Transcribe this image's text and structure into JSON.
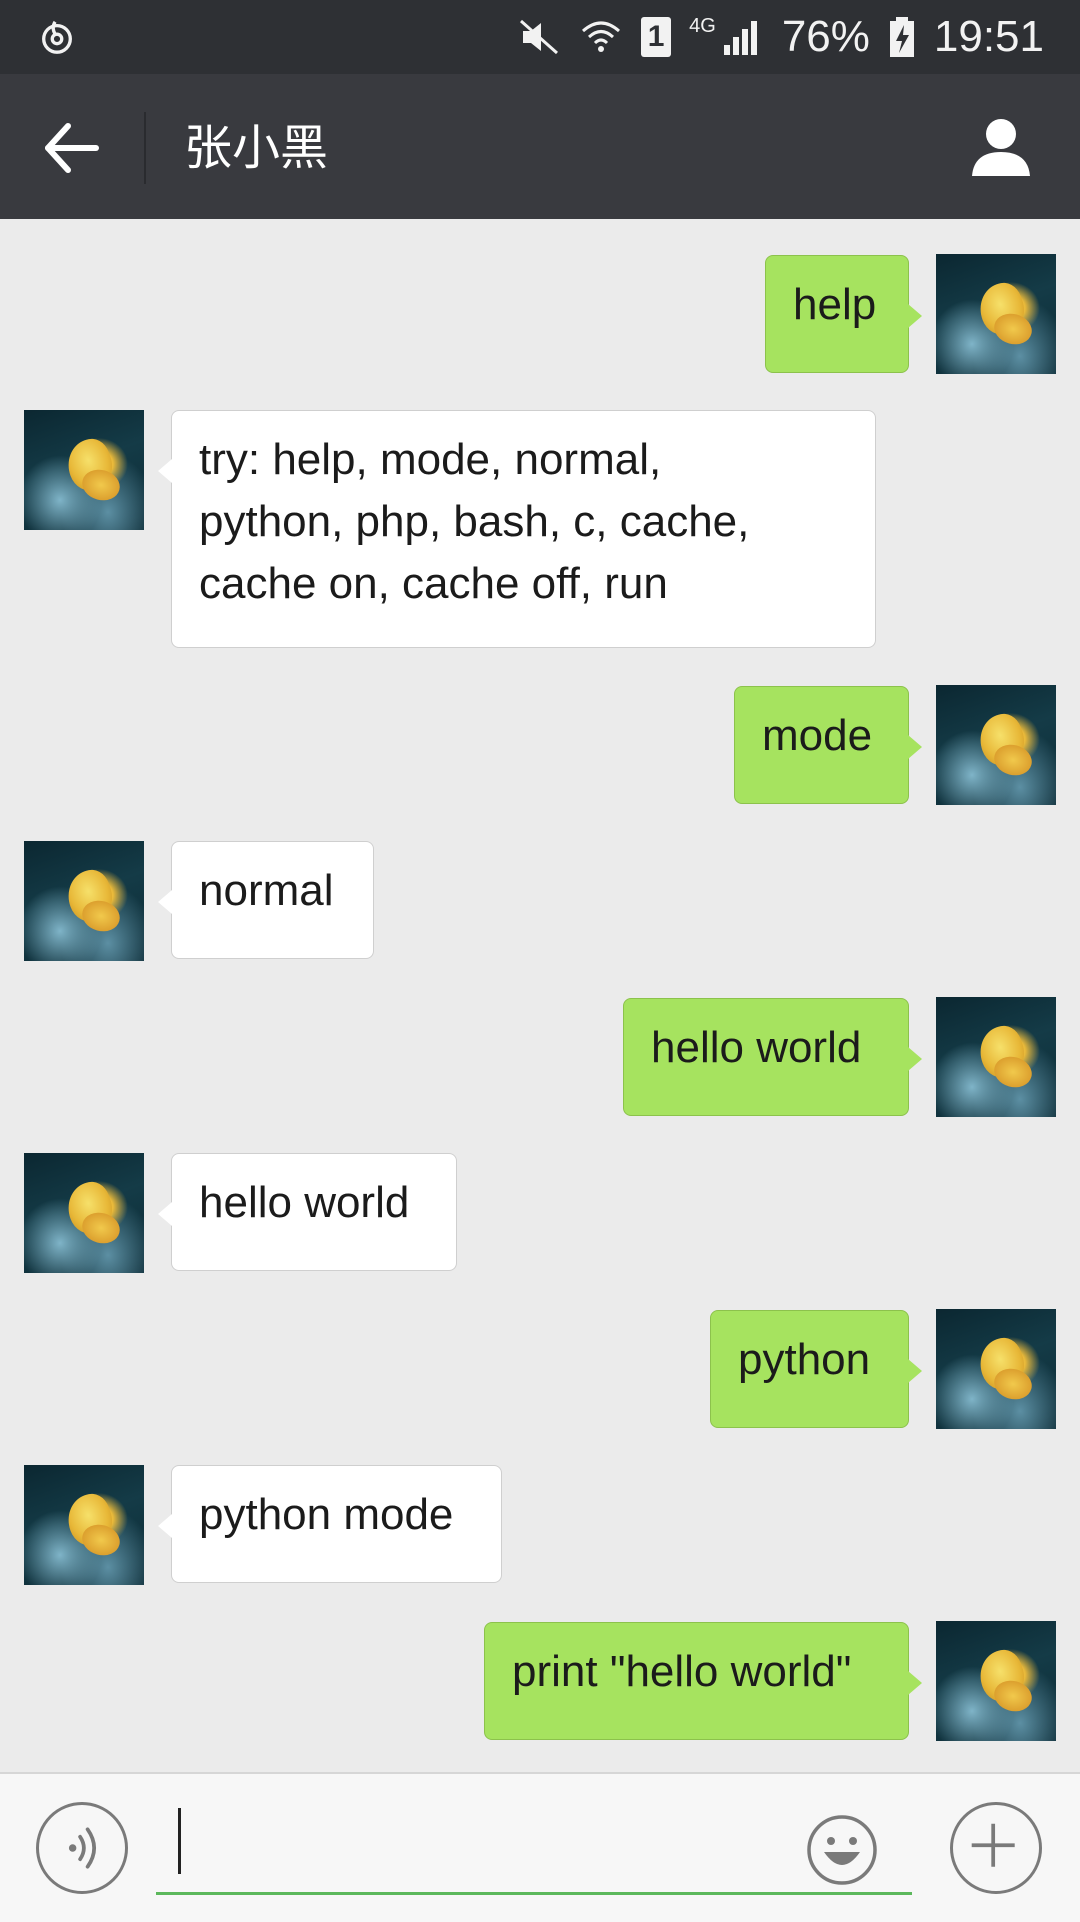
{
  "status_bar": {
    "network": "4G",
    "sim": "1",
    "battery": "76%",
    "time": "19:51"
  },
  "header": {
    "title": "张小黑"
  },
  "messages": [
    {
      "direction": "out",
      "text": "help"
    },
    {
      "direction": "in",
      "text": "try: help, mode, normal,\npython, php, bash, c, cache,\ncache on, cache off, run"
    },
    {
      "direction": "out",
      "text": "mode"
    },
    {
      "direction": "in",
      "text": "normal"
    },
    {
      "direction": "out",
      "text": "hello world"
    },
    {
      "direction": "in",
      "text": "hello world"
    },
    {
      "direction": "out",
      "text": "python"
    },
    {
      "direction": "in",
      "text": "python mode"
    },
    {
      "direction": "out",
      "text": "print \"hello world\""
    }
  ],
  "input": {
    "value": ""
  },
  "colors": {
    "outgoing_bubble": "#a6e35f",
    "incoming_bubble": "#ffffff",
    "nav_bar": "#393a3f",
    "status_bar": "#2e3034",
    "chat_background": "#ebebeb",
    "input_underline": "#5cb85c"
  }
}
